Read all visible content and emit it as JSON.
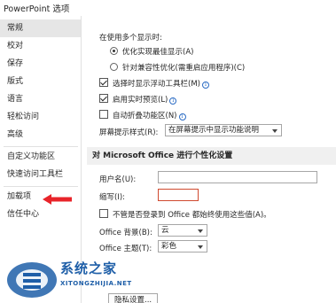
{
  "window": {
    "title": "PowerPoint 选项"
  },
  "sidebar": {
    "items": [
      {
        "label": "常规",
        "selected": true
      },
      {
        "label": "校对"
      },
      {
        "label": "保存"
      },
      {
        "label": "版式"
      },
      {
        "label": "语言"
      },
      {
        "label": "轻松访问"
      },
      {
        "label": "高级"
      },
      {
        "label": "自定义功能区"
      },
      {
        "label": "快速访问工具栏"
      },
      {
        "label": "加载项"
      },
      {
        "label": "信任中心"
      }
    ]
  },
  "ui_options": {
    "multi_display_label": "在使用多个显示时:",
    "radio_optimize_label": "优化实现最佳显示(A)",
    "radio_optimize_selected": true,
    "radio_compat_label": "针对兼容性优化(需重启应用程序)(C)",
    "radio_compat_selected": false,
    "cb_minitoolbar_label": "选择时显示浮动工具栏(M)",
    "cb_minitoolbar_checked": true,
    "cb_livepreview_label": "启用实时预览(L)",
    "cb_livepreview_checked": true,
    "cb_collapse_label": "自动折叠功能区(N)",
    "cb_collapse_checked": false,
    "screentip_label": "屏幕提示样式(R):",
    "screentip_value": "在屏幕提示中显示功能说明"
  },
  "personalize": {
    "heading": "对 Microsoft Office 进行个性化设置",
    "username_label": "用户名(U):",
    "username_value": "",
    "initials_label": "缩写(I):",
    "initials_value": "",
    "always_use_label": "不管是否登录到 Office 都始终使用这些值(A)。",
    "always_use_checked": false,
    "background_label": "Office 背景(B):",
    "background_value": "云",
    "theme_label": "Office 主题(T):",
    "theme_value": "彩色"
  },
  "bottom_button": {
    "label": "隐私设置..."
  },
  "watermark": {
    "text": "系统之家",
    "sub": "XITONGZHIJIA.NET"
  },
  "colors": {
    "annotation_arrow": "#e8242a",
    "selected_nav": "#e6e6e6",
    "watermark": "#1f5fa8"
  }
}
